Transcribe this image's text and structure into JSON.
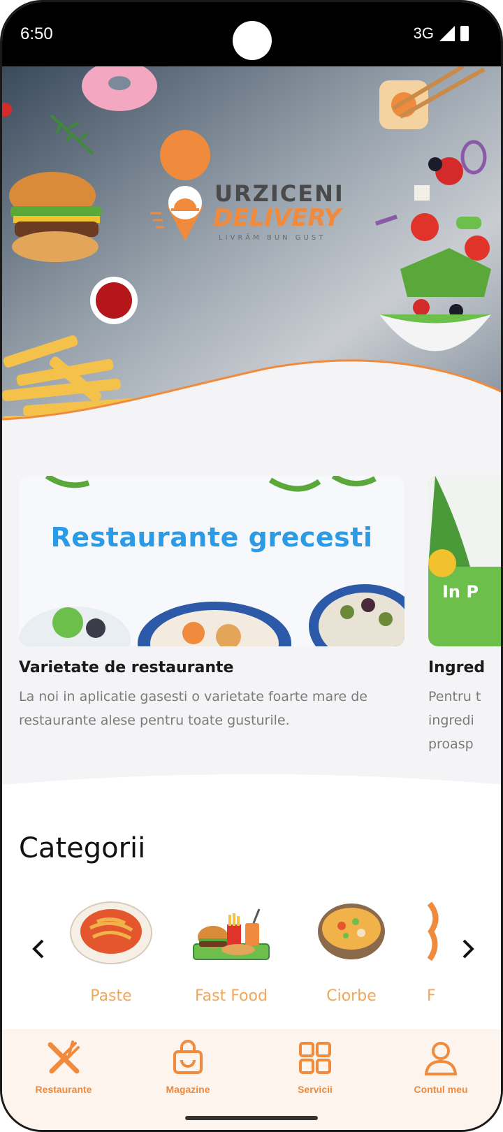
{
  "status_bar": {
    "time": "6:50",
    "network": "3G"
  },
  "hero": {
    "logo_line1": "URZICENI",
    "logo_line2": "DELIVERY",
    "logo_tagline": "LIVRĂM BUN GUST"
  },
  "promos": [
    {
      "image_text": "Restaurante grecesti",
      "title": "Varietate de restaurante",
      "description": "La noi in aplicatie gasesti o varietate foarte mare de restaurante alese pentru toate gusturile."
    },
    {
      "image_text": "In P",
      "title": "Ingred",
      "description_lines": [
        "Pentru t",
        "ingredi",
        "proasp"
      ]
    }
  ],
  "categories": {
    "heading": "Categorii",
    "items": [
      {
        "label": "Paste",
        "icon": "pasta-icon"
      },
      {
        "label": "Fast Food",
        "icon": "fast-food-icon"
      },
      {
        "label": "Ciorbe",
        "icon": "soup-icon"
      },
      {
        "label": "F",
        "icon": "partial-category-icon"
      }
    ]
  },
  "bottom_nav": [
    {
      "label": "Restaurante",
      "icon": "utensils-icon"
    },
    {
      "label": "Magazine",
      "icon": "shopping-bag-icon"
    },
    {
      "label": "Servicii",
      "icon": "grid-icon"
    },
    {
      "label": "Contul meu",
      "icon": "user-icon"
    }
  ],
  "colors": {
    "accent": "#f08a3c",
    "category_label": "#f2a65a",
    "promo_heading": "#2b9be6",
    "nav_bg": "#fdf4ee"
  }
}
